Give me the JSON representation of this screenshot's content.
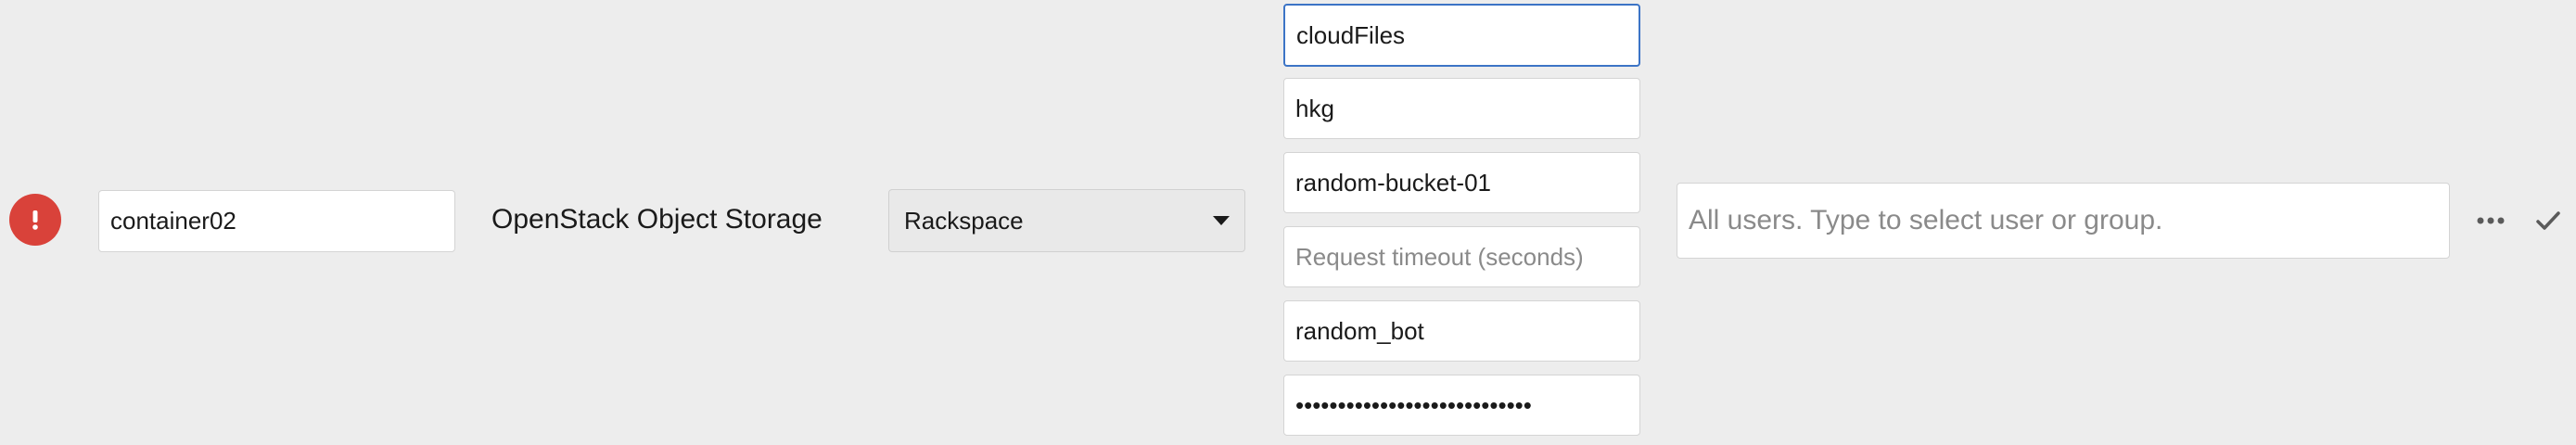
{
  "row": {
    "status_icon": "error-exclamation-icon",
    "name_value": "container02",
    "backend_type": "OpenStack Object Storage",
    "provider_select": {
      "selected": "Rackspace"
    },
    "fields": {
      "service_name": "cloudFiles",
      "region": "hkg",
      "container": "random-bucket-01",
      "timeout_placeholder": "Request timeout (seconds)",
      "username": "random_bot",
      "password": "••••••••••••••••••••••••••••"
    },
    "users_placeholder": "All users. Type to select user or group.",
    "actions": {
      "more_icon": "more-horizontal-icon",
      "confirm_icon": "checkmark-icon"
    }
  },
  "colors": {
    "error": "#d9423a",
    "focus_border": "#3c74c6",
    "background": "#ededed"
  }
}
